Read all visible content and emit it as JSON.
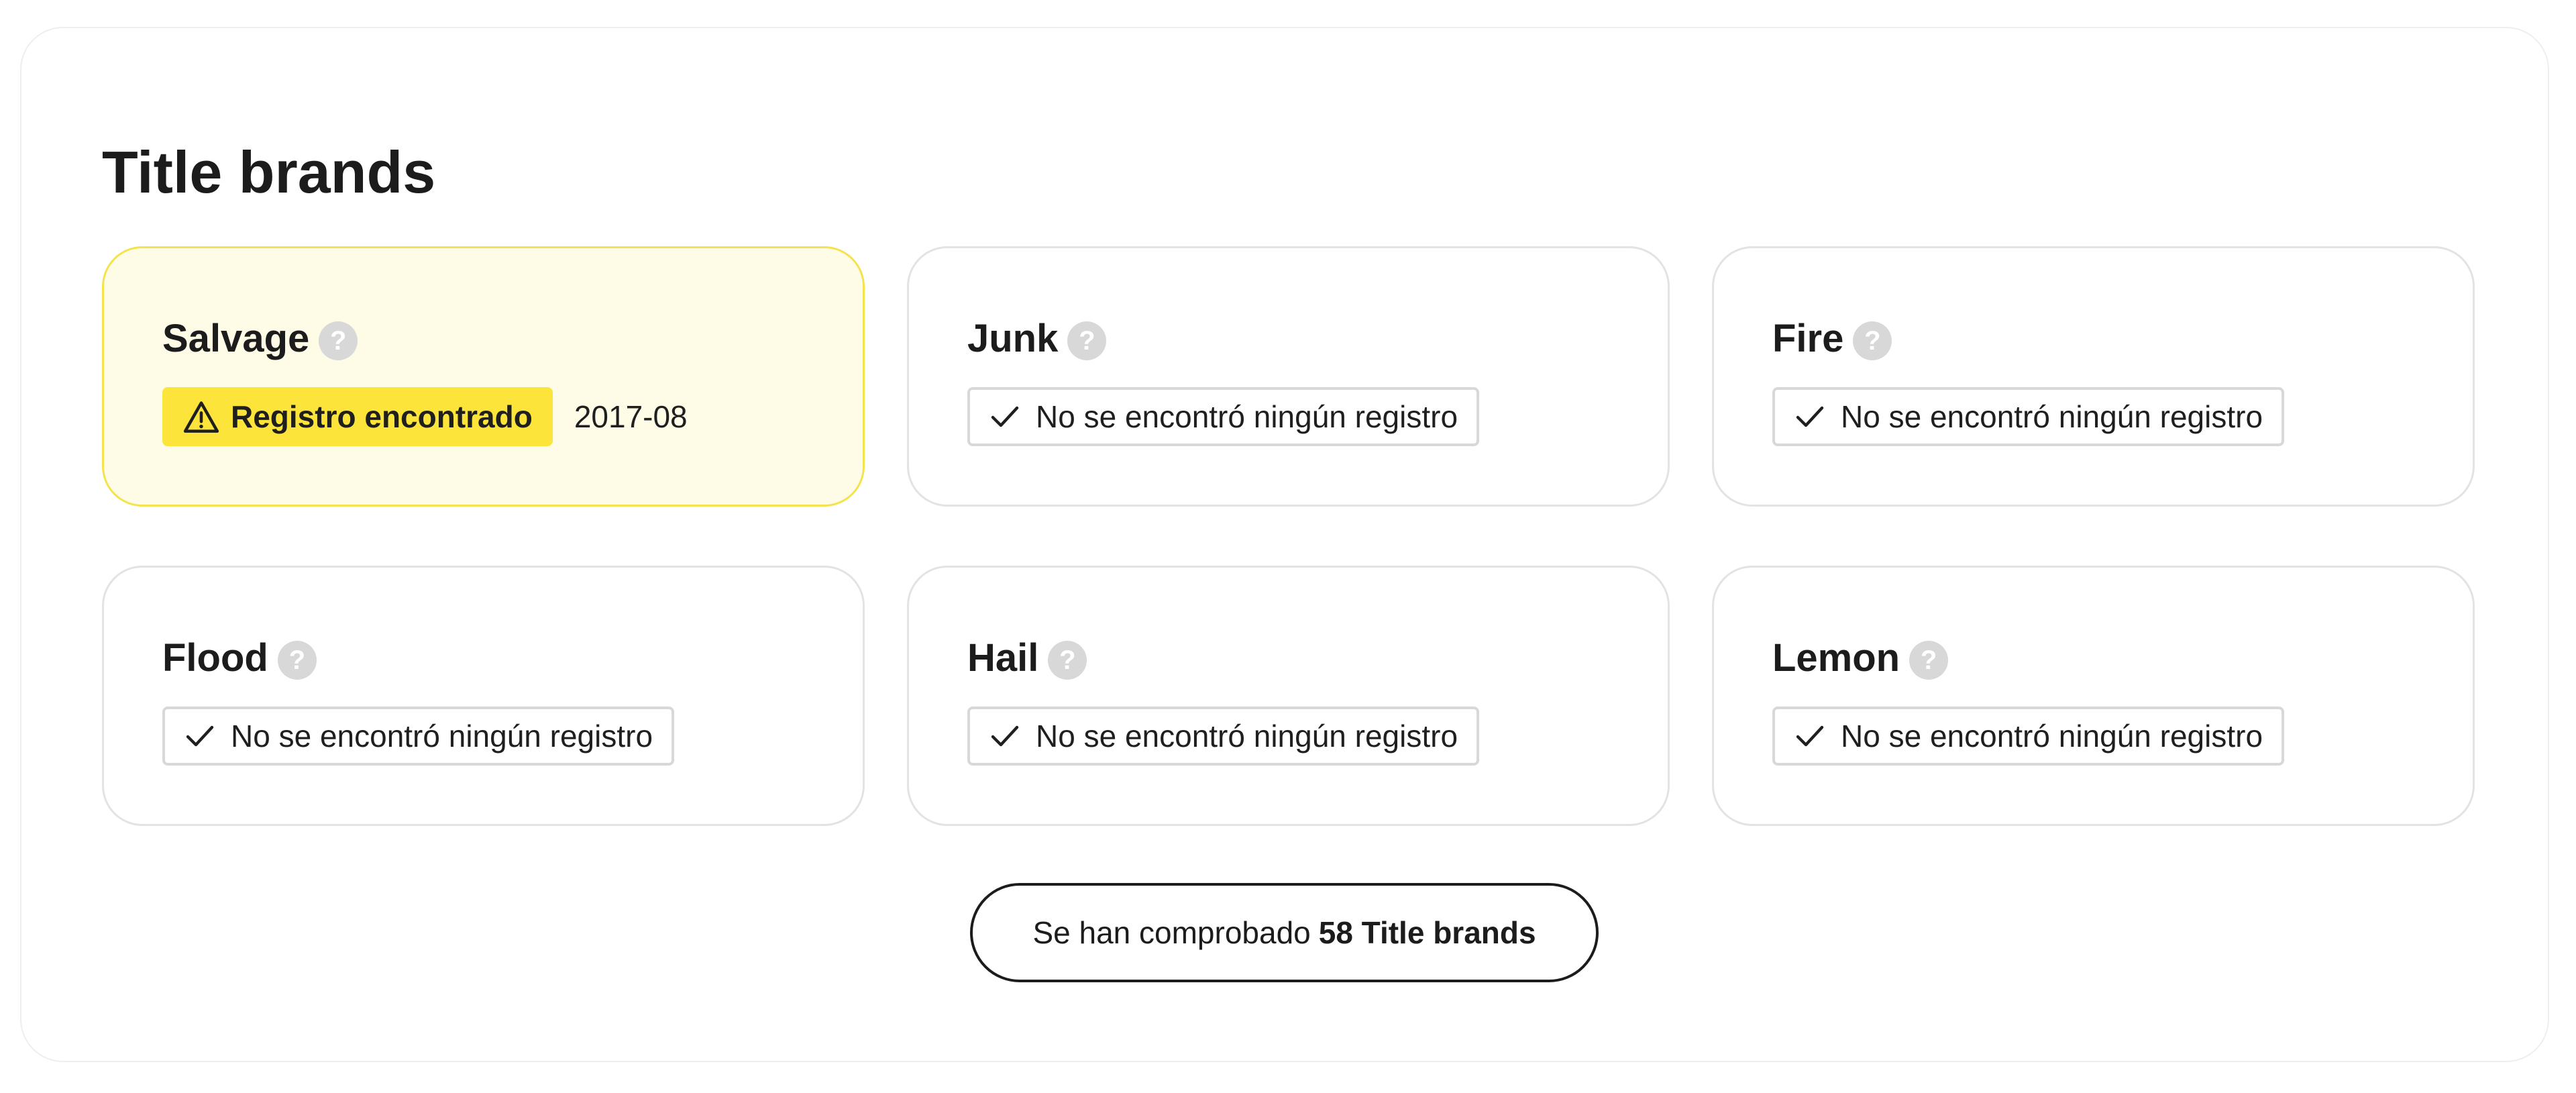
{
  "section": {
    "title": "Title brands"
  },
  "cards": [
    {
      "name": "Salvage",
      "help": "?",
      "status": "Registro encontrado",
      "status_type": "found",
      "date": "2017-08"
    },
    {
      "name": "Junk",
      "help": "?",
      "status": "No se encontró ningún registro",
      "status_type": "clear"
    },
    {
      "name": "Fire",
      "help": "?",
      "status": "No se encontró ningún registro",
      "status_type": "clear"
    },
    {
      "name": "Flood",
      "help": "?",
      "status": "No se encontró ningún registro",
      "status_type": "clear"
    },
    {
      "name": "Hail",
      "help": "?",
      "status": "No se encontró ningún registro",
      "status_type": "clear"
    },
    {
      "name": "Lemon",
      "help": "?",
      "status": "No se encontró ningún registro",
      "status_type": "clear"
    }
  ],
  "summary_button": {
    "prefix": "Se han comprobado",
    "count_label": "58 Title brands"
  },
  "icons": {
    "help": "question-mark-icon",
    "found": "warning-triangle-icon",
    "clear": "checkmark-icon"
  },
  "colors": {
    "alert_background": "#fefbe6",
    "alert_border": "#f4e34d",
    "found_badge": "#fde43a",
    "help_icon": "#d8d8d8",
    "card_border": "#e3e3e3",
    "text": "#1c1c1c"
  }
}
